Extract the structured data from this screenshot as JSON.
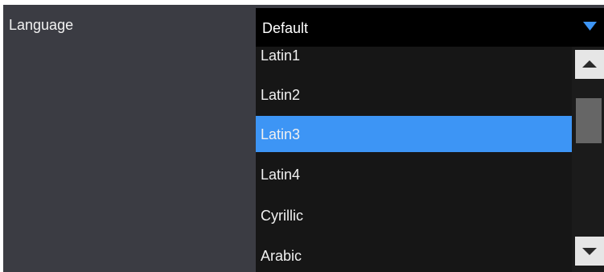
{
  "language_row": {
    "label": "Language"
  },
  "language_select": {
    "selected_value": "Default",
    "options": [
      {
        "label": "Latin1",
        "selected": false
      },
      {
        "label": "Latin2",
        "selected": false
      },
      {
        "label": "Latin3",
        "selected": true
      },
      {
        "label": "Latin4",
        "selected": false
      },
      {
        "label": "Cyrillic",
        "selected": false
      },
      {
        "label": "Arabic",
        "selected": false
      }
    ]
  },
  "icons": {
    "dropdown": "chevron-down-icon",
    "scroll_up": "scroll-up-icon",
    "scroll_down": "scroll-down-icon"
  },
  "colors": {
    "panel_background": "#3b3c43",
    "highlight": "#3d95f5",
    "combo_background": "#000000",
    "list_background": "#161616",
    "scroll_button": "#e6e6e6",
    "scroll_thumb": "#666666"
  }
}
